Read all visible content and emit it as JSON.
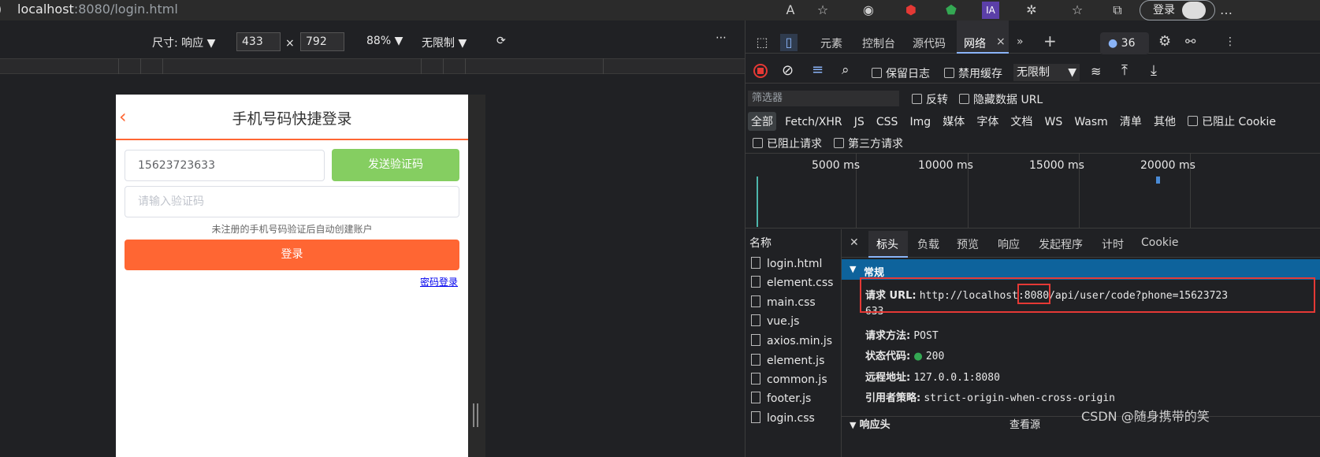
{
  "browser": {
    "url_host": "localhost",
    "url_rest": ":8080/login.html",
    "login_label": "登录"
  },
  "device_toolbar": {
    "size_label": "尺寸: 响应",
    "width": "433",
    "times": "×",
    "height": "792",
    "zoom": "88%",
    "throttle": "无限制"
  },
  "app": {
    "title": "手机号码快捷登录",
    "phone_value": "15623723633",
    "send_code_label": "发送验证码",
    "code_placeholder": "请输入验证码",
    "hint": "未注册的手机号码验证后自动创建账户",
    "login_label": "登录",
    "password_login_link": "密码登录"
  },
  "devtools": {
    "tabs": [
      "元素",
      "控制台",
      "源代码",
      "网络"
    ],
    "message_count": "36",
    "toolbar": {
      "preserve_log": "保留日志",
      "disable_cache": "禁用缓存",
      "throttle": "无限制"
    },
    "filter_placeholder": "筛选器",
    "invert": "反转",
    "hide_data_urls": "隐藏数据 URL",
    "types": [
      "全部",
      "Fetch/XHR",
      "JS",
      "CSS",
      "Img",
      "媒体",
      "字体",
      "文档",
      "WS",
      "Wasm",
      "清单",
      "其他"
    ],
    "blocked_cookies": "已阻止 Cookie",
    "blocked_requests": "已阻止请求",
    "third_party": "第三方请求",
    "timeline_ticks": [
      "5000 ms",
      "10000 ms",
      "15000 ms",
      "20000 ms"
    ],
    "name_header": "名称",
    "files": [
      "login.html",
      "element.css",
      "main.css",
      "vue.js",
      "axios.min.js",
      "element.js",
      "common.js",
      "footer.js",
      "login.css"
    ],
    "detail_tabs": [
      "标头",
      "负载",
      "预览",
      "响应",
      "发起程序",
      "计时",
      "Cookie"
    ],
    "general_label": "常规",
    "request_url_key": "请求 URL:",
    "request_url_pre": "http://localhost:",
    "request_url_port": "8080",
    "request_url_post": "/api/user/code?phone=15623723",
    "request_url_wrap": "633",
    "method_key": "请求方法:",
    "method_value": "POST",
    "status_key": "状态代码:",
    "status_value": "200",
    "remote_key": "远程地址:",
    "remote_value": "127.0.0.1:8080",
    "referrer_key": "引用者策略:",
    "referrer_value": "strict-origin-when-cross-origin",
    "response_headers": "响应头",
    "view_source": "查看源"
  },
  "watermark": "CSDN @随身携带的笑"
}
